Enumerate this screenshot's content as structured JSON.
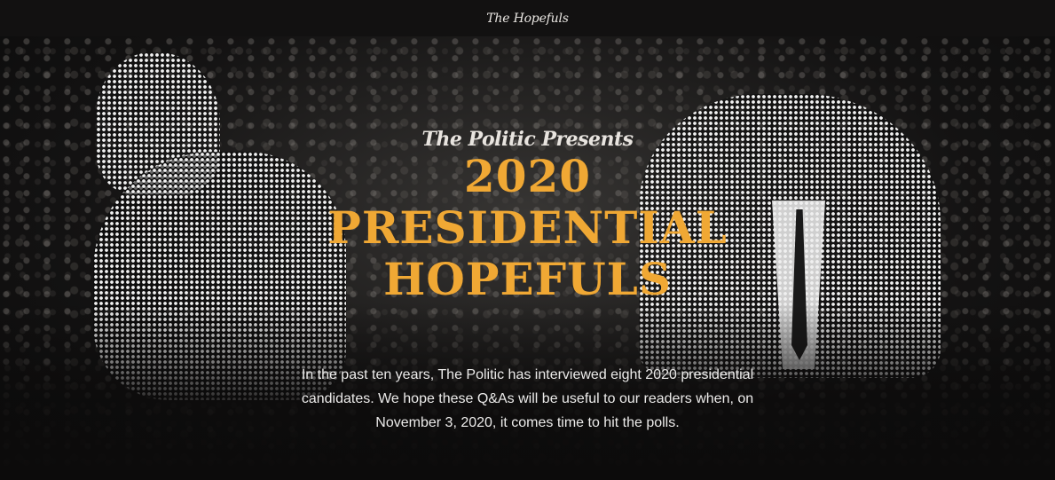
{
  "header": {
    "site_title": "The Hopefuls"
  },
  "hero": {
    "presents": "The Politic Presents",
    "title_lines": [
      "2020",
      "PRESIDENTIAL",
      "HOPEFULS"
    ],
    "intro_lines": [
      "In the past ten years, The Politic has interviewed eight 2020 presidential",
      "candidates. We hope these Q&As will be useful to our readers when, on",
      "November 3, 2020, it comes time to hit the polls."
    ]
  },
  "colors": {
    "accent": "#f0a834",
    "background": "#0c0b0b",
    "text": "#ecebea"
  }
}
